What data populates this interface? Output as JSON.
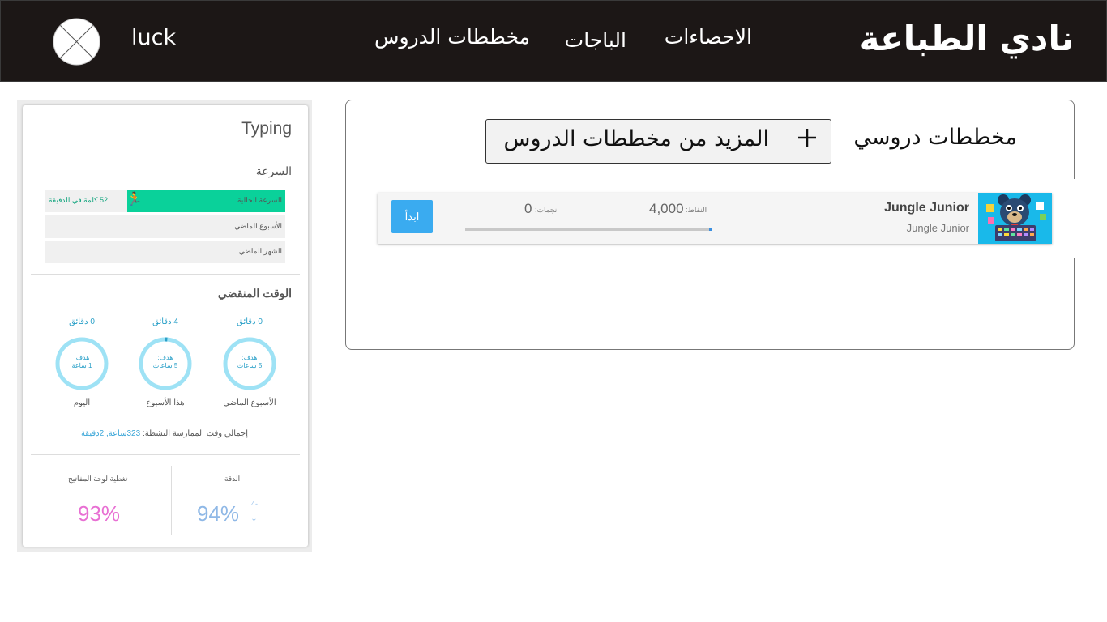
{
  "header": {
    "brand": "نادي الطباعة",
    "nav": [
      {
        "label": "الاحصاءات"
      },
      {
        "label": "الباجات"
      },
      {
        "label": "مخططات الدروس"
      }
    ],
    "username": "luck",
    "avatar_icon": "avatar-placeholder-icon"
  },
  "stats": {
    "title": "Typing",
    "speed": {
      "title": "السرعة",
      "rows": [
        {
          "label": "السرعة الحالية",
          "value": "52 كلمة في الدقيقة",
          "fill_fraction": 0.66
        },
        {
          "label": "الأسبوع الماضي",
          "value": "",
          "fill_fraction": 0
        },
        {
          "label": "الشهر الماضي",
          "value": "",
          "fill_fraction": 0
        }
      ],
      "accent": "#0ad19a"
    },
    "time": {
      "title": "الوقت المنقضي",
      "rings": [
        {
          "caption": "الأسبوع الماضي",
          "top": "0 دقائق",
          "goal_line1": "هدف:",
          "goal_line2": "5 ساعات",
          "progress": 0
        },
        {
          "caption": "هذا الأسبوع",
          "top": "4 دقائق",
          "goal_line1": "هدف:",
          "goal_line2": "5 ساعات",
          "progress": 0.013
        },
        {
          "caption": "اليوم",
          "top": "0 دقائق",
          "goal_line1": "هدف:",
          "goal_line2": "1 ساعة",
          "progress": 0
        }
      ],
      "total_label": "إجمالي وقت الممارسة النشطة:",
      "total_value": "323ساعة, 2دقيقة"
    },
    "accuracy": {
      "label": "الدقة",
      "value": "94%",
      "delta": "4-"
    },
    "coverage": {
      "label": "تغطية لوحة المفاتيح",
      "value": "93%"
    },
    "colors": {
      "ring": "#9ee2f5",
      "ring_progress": "#2aa0c8",
      "coverage": "#e86fd3",
      "accuracy": "#8fb8e6"
    }
  },
  "plans": {
    "title": "مخططات دروسي",
    "more_button": "المزيد من مخططات الدروس",
    "courses": [
      {
        "name": "Jungle Junior",
        "subtitle": "Jungle Junior",
        "points_label": "النقاط:",
        "points": "4,000",
        "stars_label": "نجمات:",
        "stars": "0",
        "progress": 0.01,
        "start_label": "ابدأ",
        "thumbnail": "jungle-junior-bear-keyboard"
      }
    ]
  }
}
